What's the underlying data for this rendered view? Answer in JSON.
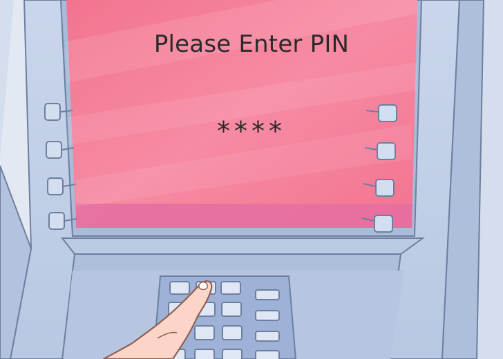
{
  "screen": {
    "prompt": "Please Enter PIN",
    "pin_mask": "****",
    "color": "#f67c98"
  },
  "side_keys": {
    "left": [
      "",
      "",
      "",
      ""
    ],
    "right": [
      "",
      "",
      "",
      ""
    ]
  },
  "keypad": {
    "rows": 5,
    "number_key_columns": 3,
    "function_key_columns": 1,
    "pressing_key": "top-left key"
  },
  "colors": {
    "machine_body": "#c5d3ea",
    "machine_outline": "#6d7f9e",
    "wall": "#e2e8f2",
    "skin": "#fbd5c7"
  }
}
